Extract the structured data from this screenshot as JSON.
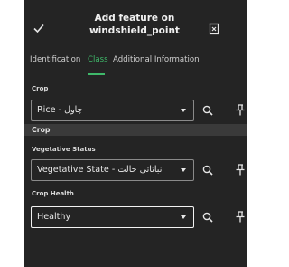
{
  "header": {
    "title_line1": "Add feature on",
    "title_line2": "windshield_point"
  },
  "tabs": [
    {
      "label": "Identification"
    },
    {
      "label": "Class"
    },
    {
      "label": "Additional Information"
    }
  ],
  "active_tab": "Class",
  "fields": {
    "crop": {
      "label": "Crop",
      "value": "Rice - چاول"
    },
    "vegetative_status": {
      "label": "Vegetative Status",
      "value": "Vegetative State - نباتاتی حالت"
    },
    "crop_health": {
      "label": "Crop Health",
      "value": "Healthy"
    }
  },
  "section": {
    "title": "Crop"
  },
  "icons": [
    "check-icon",
    "discard-icon",
    "search-icon",
    "pin-icon",
    "chevron-down-icon"
  ],
  "colors": {
    "background": "#242424",
    "accent": "#3fb96a",
    "section_bar": "#3a3a3a"
  }
}
